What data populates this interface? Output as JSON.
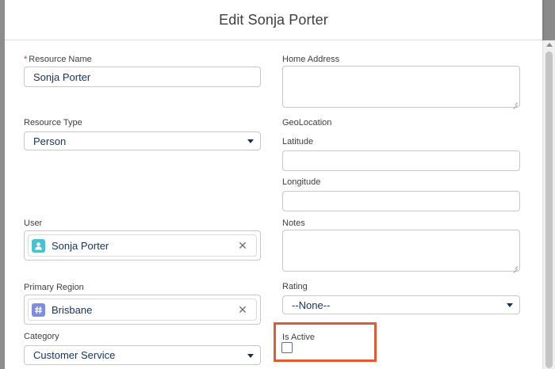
{
  "modal": {
    "title": "Edit Sonja Porter"
  },
  "left": {
    "resource_name": {
      "label": "Resource Name",
      "required_marker": "*",
      "value": "Sonja Porter"
    },
    "resource_type": {
      "label": "Resource Type",
      "value": "Person"
    },
    "user": {
      "label": "User",
      "value": "Sonja Porter",
      "icon": "user-icon",
      "icon_color": "#4bc0d0"
    },
    "primary_region": {
      "label": "Primary Region",
      "value": "Brisbane",
      "icon": "territory-hash-icon",
      "icon_color": "#7f8de1"
    },
    "category": {
      "label": "Category",
      "value": "Customer Service"
    }
  },
  "right": {
    "home_address": {
      "label": "Home Address",
      "value": ""
    },
    "geolocation": {
      "label": "GeoLocation"
    },
    "latitude": {
      "label": "Latitude",
      "value": ""
    },
    "longitude": {
      "label": "Longitude",
      "value": ""
    },
    "notes": {
      "label": "Notes",
      "value": ""
    },
    "rating": {
      "label": "Rating",
      "value": "--None--"
    },
    "is_active": {
      "label": "Is Active",
      "checked": false,
      "highlight_color": "#e25a34"
    }
  },
  "clear_glyph": "✕"
}
